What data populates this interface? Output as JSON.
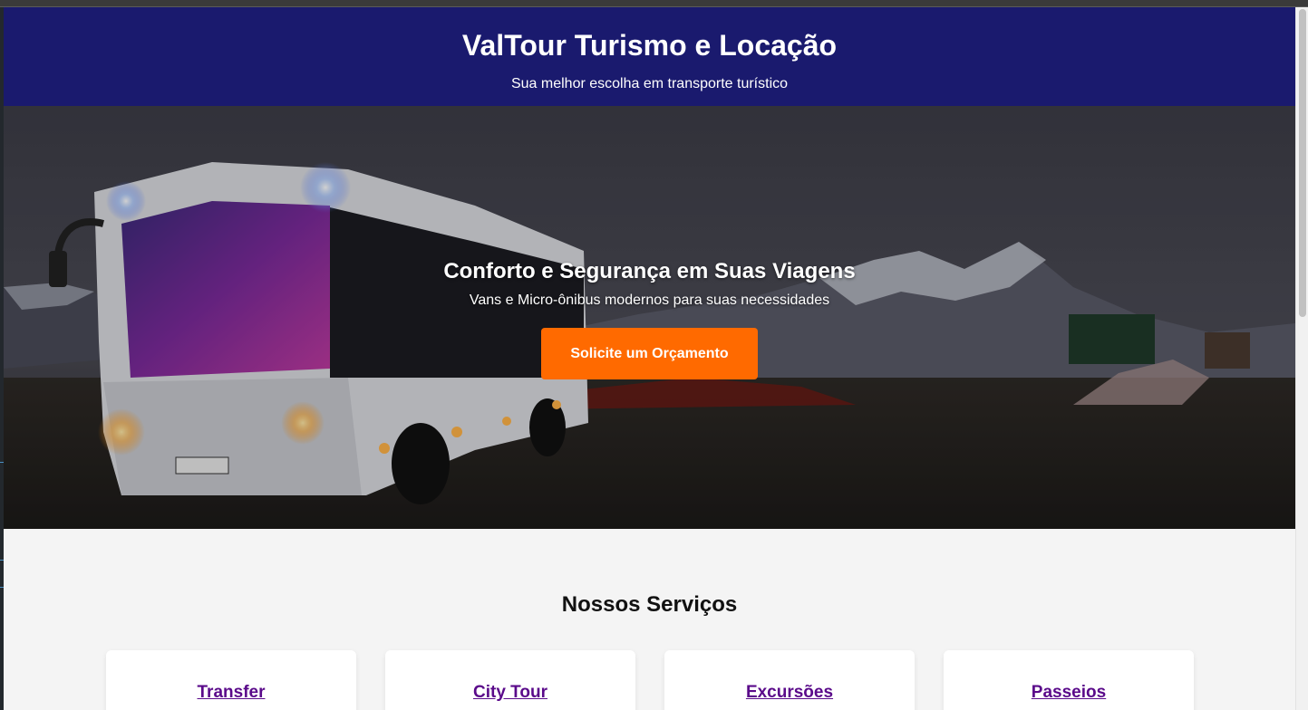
{
  "header": {
    "title": "ValTour Turismo e Locação",
    "tagline": "Sua melhor escolha em transporte turístico"
  },
  "hero": {
    "title": "Conforto e Segurança em Suas Viagens",
    "subtitle": "Vans e Micro-ônibus modernos para suas necessidades",
    "cta_label": "Solicite um Orçamento",
    "image": "night-tour-bus-mountains"
  },
  "services": {
    "title": "Nossos Serviços",
    "items": [
      {
        "label": "Transfer"
      },
      {
        "label": "City Tour"
      },
      {
        "label": "Excursões"
      },
      {
        "label": "Passeios"
      }
    ]
  },
  "colors": {
    "header_bg": "#1a1a6e",
    "cta_bg": "#ff6a00",
    "link": "#5a0a8a",
    "page_bg": "#f4f4f4"
  }
}
